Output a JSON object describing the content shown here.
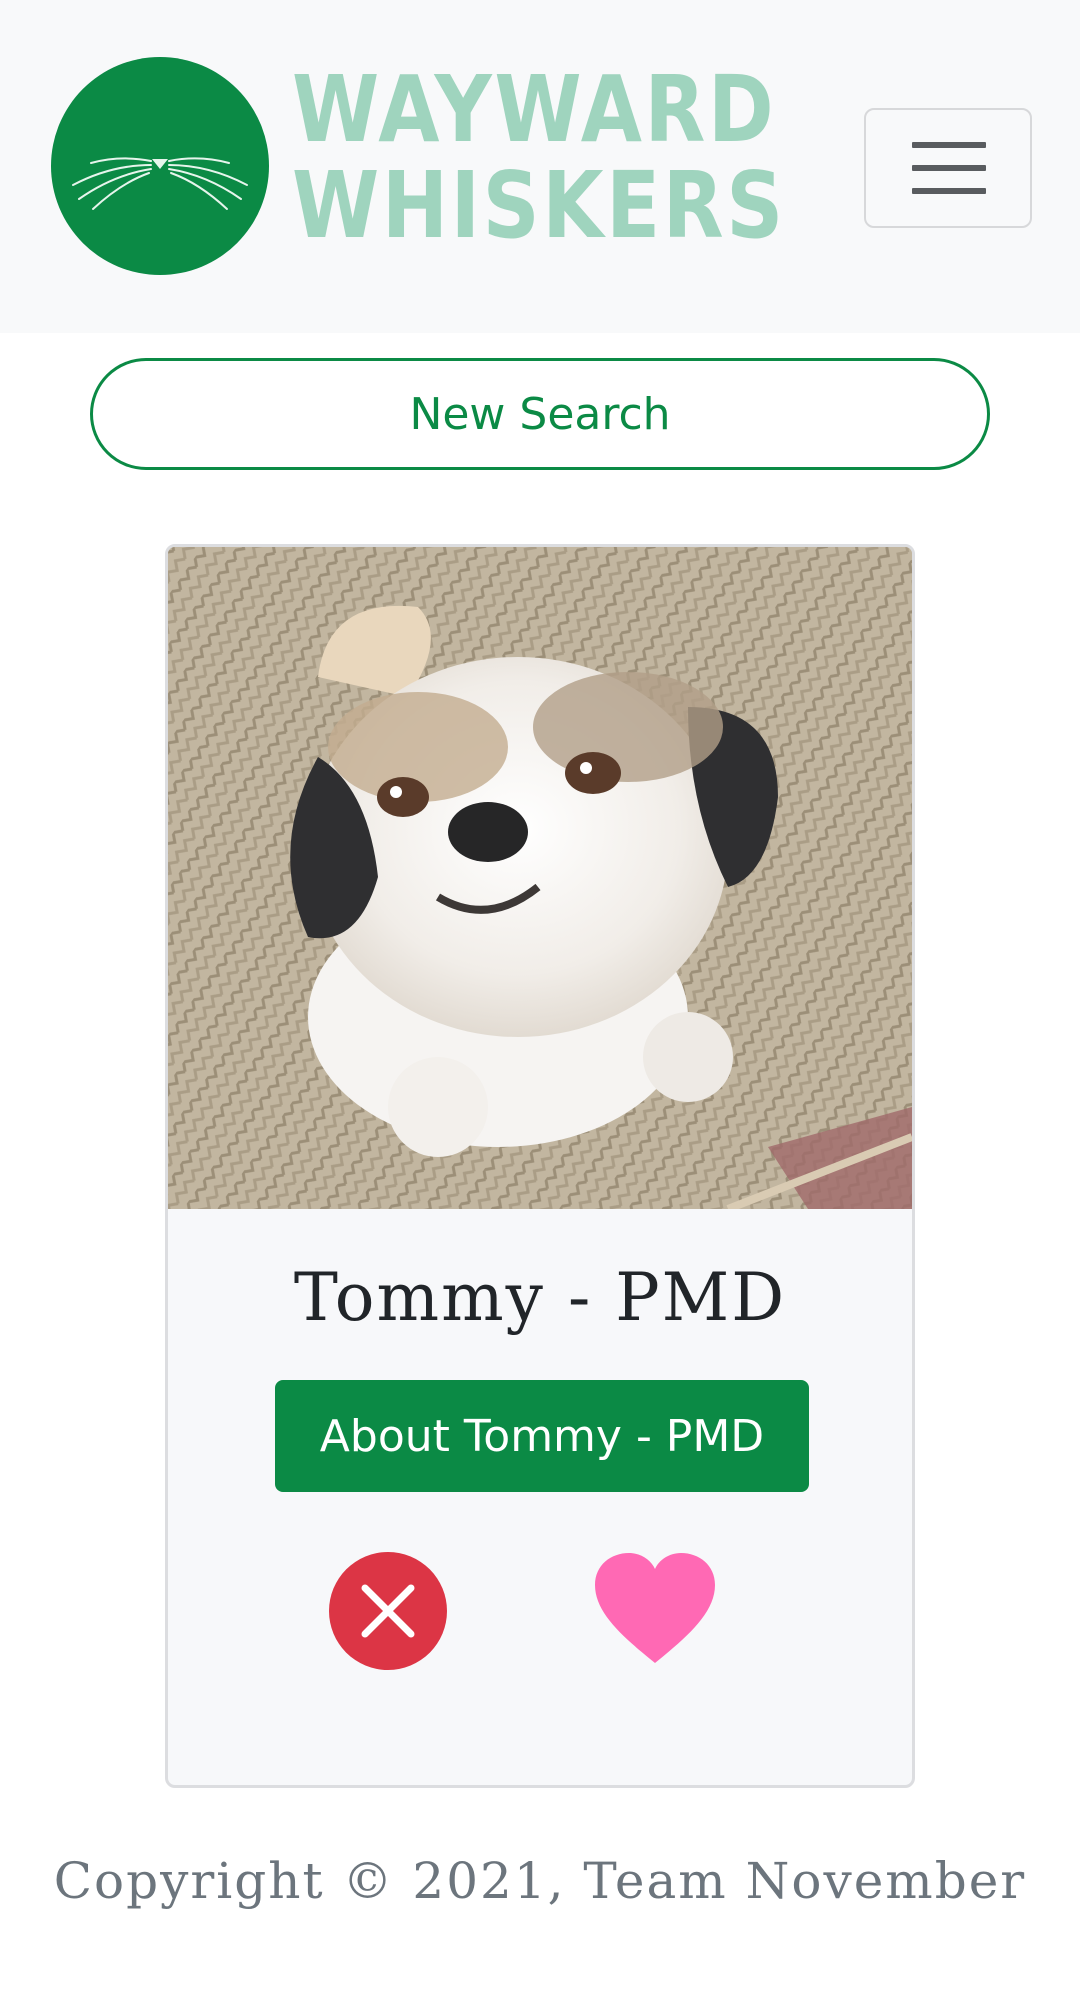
{
  "header": {
    "brand_line1": "WAYWARD",
    "brand_line2": "WHISKERS",
    "logo_icon": "cat-whiskers-icon",
    "menu_icon": "hamburger-icon",
    "brand_color": "#0b8a45",
    "brand_text_color": "#9fd4be"
  },
  "search": {
    "new_search_label": "New Search"
  },
  "card": {
    "pet_photo": "dog-photo",
    "pet_name": "Tommy - PMD",
    "about_label": "About Tommy - PMD",
    "reject_icon": "close-icon",
    "like_icon": "heart-icon",
    "reject_color": "#dc3545",
    "like_color": "#ff69b4"
  },
  "footer": {
    "copyright": "Copyright © 2021, Team November"
  }
}
